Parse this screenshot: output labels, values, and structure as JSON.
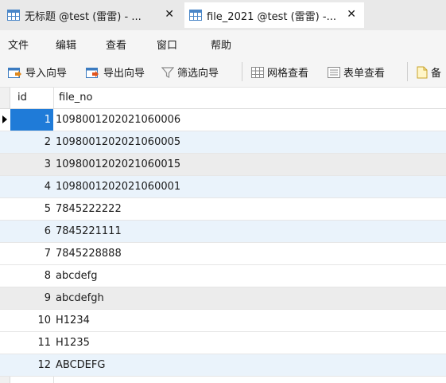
{
  "tabs": [
    {
      "label": "无标题 @test (雷雷) - ...",
      "close": "✕",
      "active": false,
      "icon": "table-icon"
    },
    {
      "label": "file_2021 @test (雷雷) -...",
      "close": "✕",
      "active": true,
      "icon": "table-icon"
    }
  ],
  "menu": [
    "文件",
    "编辑",
    "查看",
    "窗口",
    "帮助"
  ],
  "toolbar": {
    "import": "导入向导",
    "export": "导出向导",
    "filter": "筛选向导",
    "grid_view": "网格查看",
    "form_view": "表单查看",
    "partial_next": "备"
  },
  "grid": {
    "columns": [
      "id",
      "file_no"
    ],
    "rows": [
      {
        "id": "1",
        "file_no": "1098001202021060006"
      },
      {
        "id": "2",
        "file_no": "1098001202021060005"
      },
      {
        "id": "3",
        "file_no": "1098001202021060015"
      },
      {
        "id": "4",
        "file_no": "1098001202021060001"
      },
      {
        "id": "5",
        "file_no": "7845222222"
      },
      {
        "id": "6",
        "file_no": "7845221111"
      },
      {
        "id": "7",
        "file_no": "7845228888"
      },
      {
        "id": "8",
        "file_no": "abcdefg"
      },
      {
        "id": "9",
        "file_no": "abcdefgh"
      },
      {
        "id": "10",
        "file_no": "H1234"
      },
      {
        "id": "11",
        "file_no": "H1235"
      },
      {
        "id": "12",
        "file_no": "ABCDEFG"
      }
    ],
    "selected_row": 1
  },
  "colors": {
    "selection": "#1f7bd8",
    "alt_row": "#eaf3fb",
    "gray_row": "#ececec"
  }
}
